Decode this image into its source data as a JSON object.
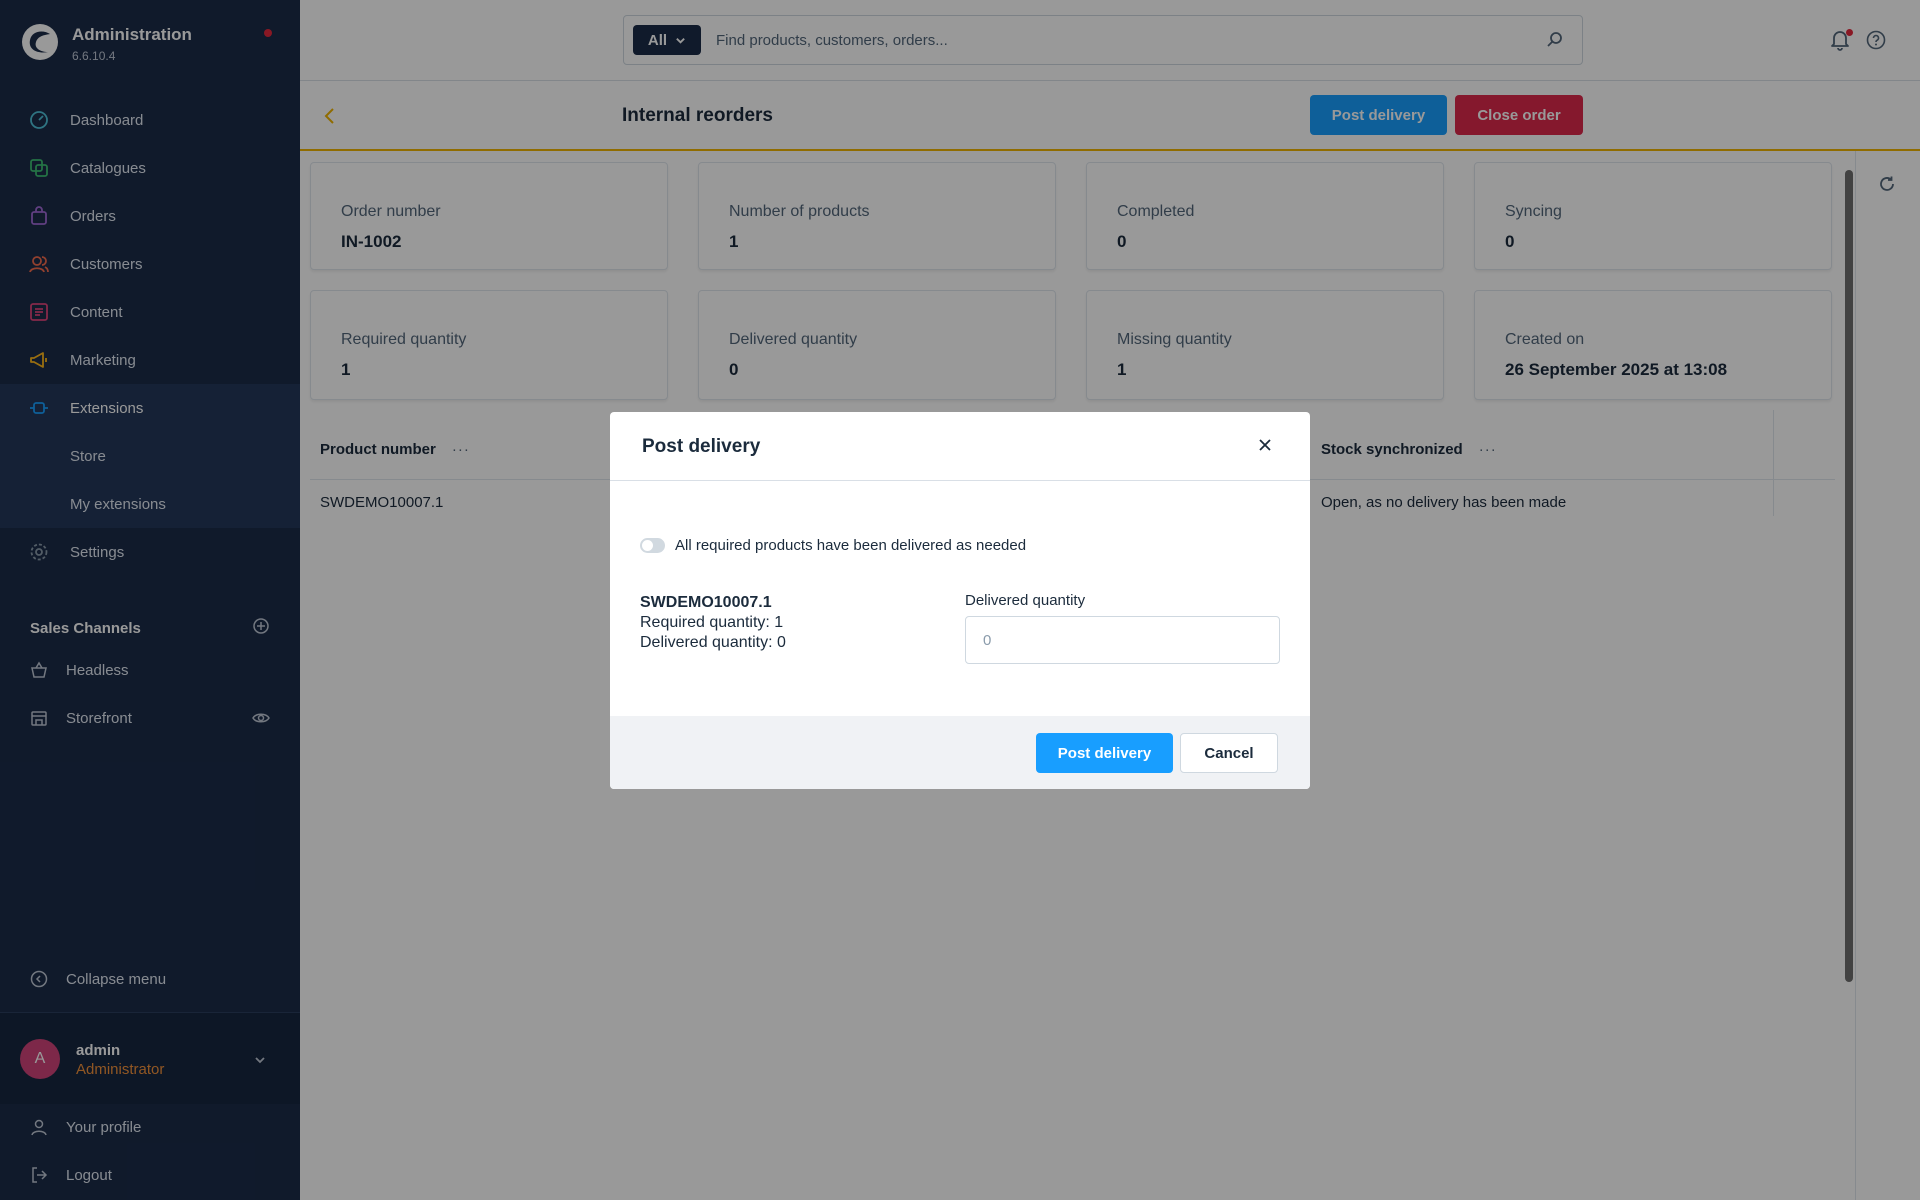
{
  "app": {
    "title": "Administration",
    "version": "6.6.10.4"
  },
  "sidebar": {
    "items": [
      {
        "label": "Dashboard",
        "icon": "dashboard-icon"
      },
      {
        "label": "Catalogues",
        "icon": "catalogues-icon"
      },
      {
        "label": "Orders",
        "icon": "orders-icon"
      },
      {
        "label": "Customers",
        "icon": "customers-icon"
      },
      {
        "label": "Content",
        "icon": "content-icon"
      },
      {
        "label": "Marketing",
        "icon": "marketing-icon"
      },
      {
        "label": "Extensions",
        "icon": "extensions-icon"
      },
      {
        "label": "Settings",
        "icon": "settings-icon"
      }
    ],
    "sub_items": [
      {
        "label": "Store"
      },
      {
        "label": "My extensions"
      }
    ],
    "sales_channels_header": "Sales Channels",
    "sales_channels": [
      {
        "label": "Headless",
        "icon": "basket-icon"
      },
      {
        "label": "Storefront",
        "icon": "storefront-icon"
      }
    ],
    "collapse_label": "Collapse menu",
    "user": {
      "initial": "A",
      "name": "admin",
      "role": "Administrator"
    },
    "footer_items": [
      {
        "label": "Your profile",
        "icon": "profile-icon"
      },
      {
        "label": "Logout",
        "icon": "logout-icon"
      }
    ]
  },
  "topbar": {
    "search_type": "All",
    "search_placeholder": "Find products, customers, orders..."
  },
  "smartbar": {
    "title": "Internal reorders",
    "post_delivery_label": "Post delivery",
    "close_order_label": "Close order"
  },
  "cards": [
    {
      "label": "Order number",
      "value": "IN-1002"
    },
    {
      "label": "Number of products",
      "value": "1"
    },
    {
      "label": "Completed",
      "value": "0"
    },
    {
      "label": "Syncing",
      "value": "0"
    },
    {
      "label": "Required quantity",
      "value": "1"
    },
    {
      "label": "Delivered quantity",
      "value": "0"
    },
    {
      "label": "Missing quantity",
      "value": "1"
    },
    {
      "label": "Created on",
      "value": "26 September 2025 at 13:08"
    }
  ],
  "grid": {
    "columns": [
      "Product number",
      "Stock synchronized"
    ],
    "column_menu": "···",
    "rows": [
      {
        "product_number": "SWDEMO10007.1",
        "stock_synchronized": "Open, as no delivery has been made"
      }
    ]
  },
  "modal": {
    "title": "Post delivery",
    "toggle_label": "All required products have been delivered as needed",
    "product_number": "SWDEMO10007.1",
    "required_quantity": "Required quantity: 1",
    "delivered_quantity": "Delivered quantity: 0",
    "field_label": "Delivered quantity",
    "field_placeholder": "0",
    "submit_label": "Post delivery",
    "cancel_label": "Cancel"
  },
  "colors": {
    "sidebar_bg": "#1b2c49",
    "primary": "#189eff",
    "danger": "#de294c",
    "accent_line": "#f0b400",
    "role_text": "#f2913b"
  }
}
